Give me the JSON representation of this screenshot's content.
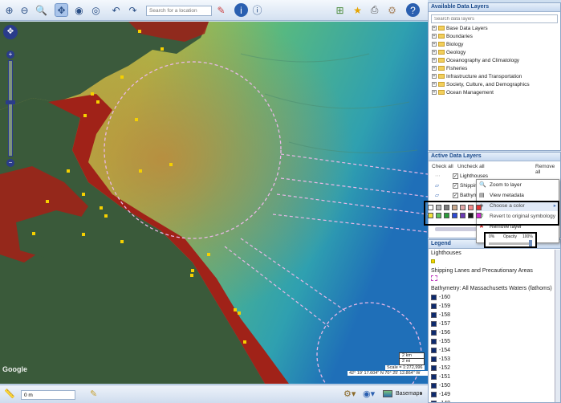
{
  "toolbar": {
    "search_placeholder": "Search for a location"
  },
  "map": {
    "attribution": "Google",
    "scale_km": "2 km",
    "scale_mi": "2 mi",
    "scale_text": "Scale = 1:272,996",
    "coords": "42° 19' 17.604\" N 70° 25' 12.864\" W"
  },
  "statusbar": {
    "measure_value": "0 m",
    "basemaps_label": "Basemaps"
  },
  "available": {
    "title": "Available Data Layers",
    "search_placeholder": "Search data layers",
    "items": [
      "Base Data Layers",
      "Boundaries",
      "Biology",
      "Geology",
      "Oceanography and Climatology",
      "Fisheries",
      "Infrastructure and Transportation",
      "Society, Culture, and Demographics",
      "Ocean Management"
    ]
  },
  "active": {
    "title": "Active Data Layers",
    "check_all": "Check all",
    "uncheck_all": "Uncheck all",
    "remove_all": "Remove all",
    "layers": [
      "Lighthouses",
      "Shipping",
      "Bathymetr"
    ]
  },
  "context_menu": {
    "zoom": "Zoom to layer",
    "metadata": "View metadata",
    "color": "Choose a color",
    "revert": "Revert to original symbology",
    "remove": "Remove layer",
    "opacity_min": "0%",
    "opacity_label": "Opacity",
    "opacity_max": "100%",
    "opacity_value": 1.0
  },
  "swatches": {
    "row1": [
      "#ffffff",
      "#b5b5b5",
      "#7b7b7b",
      "#c7a68b",
      "#e1a7a7",
      "#f28a8a",
      "#e03232"
    ],
    "row2": [
      "#f2e23a",
      "#5bc05b",
      "#2b9c3a",
      "#2d4ad4",
      "#6a3ab4",
      "#1a1a1a",
      "#cf2ad1"
    ]
  },
  "legend": {
    "title": "Legend",
    "lighthouses": "Lighthouses",
    "shipping": "Shipping Lanes and Precautionary Areas",
    "bathymetry": "Bathymetry: All Massachusetts Waters (fathoms)",
    "depths": [
      "-160",
      "-159",
      "-158",
      "-157",
      "-156",
      "-155",
      "-154",
      "-153",
      "-152",
      "-151",
      "-150",
      "-149",
      "-148"
    ]
  }
}
